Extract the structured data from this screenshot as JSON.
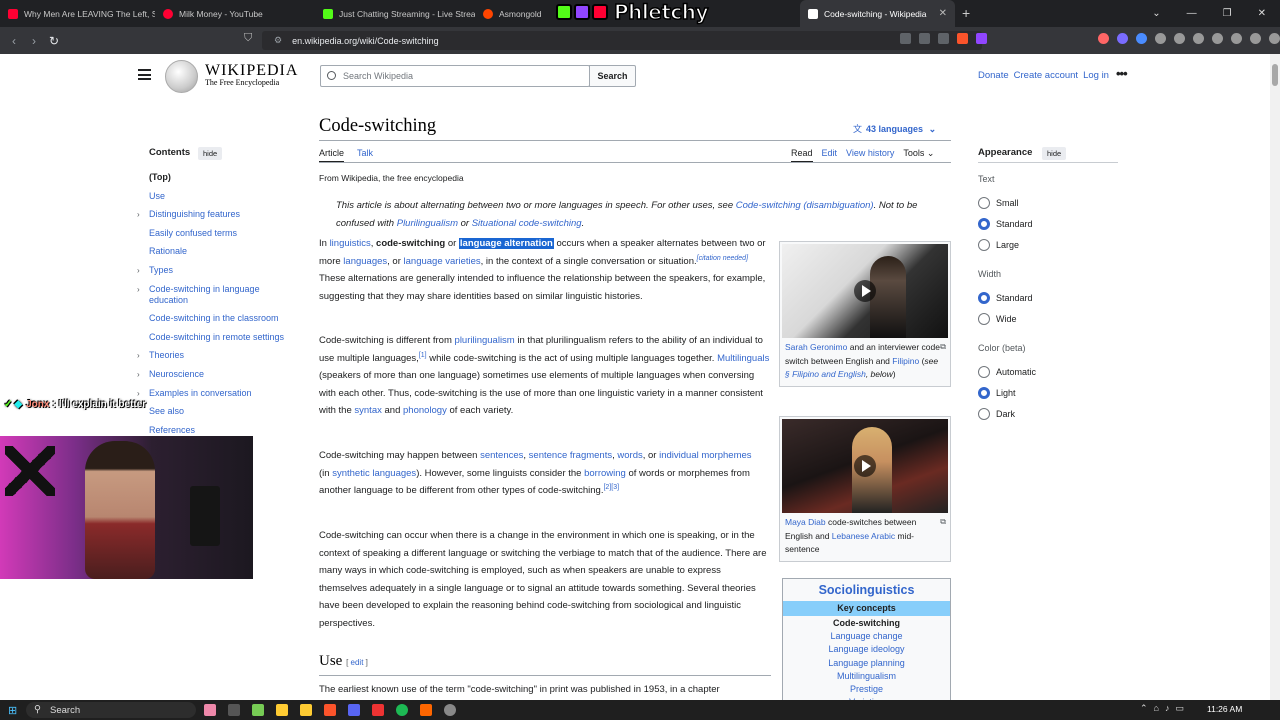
{
  "browser": {
    "tabs": [
      {
        "title": "Why Men Are LEAVING The Left, So",
        "color": "#ff0033"
      },
      {
        "title": "Milk Money - YouTube",
        "color": "#ff0033"
      },
      {
        "title": "Just Chatting Streaming - Live Strea",
        "color": "#53fc18"
      },
      {
        "title": "Asmongold",
        "color": "#ff4500"
      },
      {
        "title": "Code-switching - Wikipedia",
        "color": "#ffffff"
      }
    ],
    "overlay_text": "Phletchy",
    "url": "en.wikipedia.org/wiki/Code-switching"
  },
  "wiki": {
    "wordmark": "Wikipedia",
    "tagline": "The Free Encyclopedia",
    "search_placeholder": "Search Wikipedia",
    "search_button": "Search",
    "top_links": [
      "Donate",
      "Create account",
      "Log in"
    ],
    "toc_title": "Contents",
    "hide_label": "hide",
    "toc": [
      {
        "label": "(Top)",
        "expandable": false
      },
      {
        "label": "Use",
        "expandable": false
      },
      {
        "label": "Distinguishing features",
        "expandable": true
      },
      {
        "label": "Easily confused terms",
        "expandable": false
      },
      {
        "label": "Rationale",
        "expandable": false
      },
      {
        "label": "Types",
        "expandable": true
      },
      {
        "label": "Code-switching in language education",
        "expandable": true
      },
      {
        "label": "Code-switching in the classroom",
        "expandable": false
      },
      {
        "label": "Code-switching in remote settings",
        "expandable": false
      },
      {
        "label": "Theories",
        "expandable": true
      },
      {
        "label": "Neuroscience",
        "expandable": true
      },
      {
        "label": "Examples in conversation",
        "expandable": true
      },
      {
        "label": "See also",
        "expandable": false
      },
      {
        "label": "References",
        "expandable": false
      }
    ],
    "title": "Code-switching",
    "languages": "43 languages",
    "tabs_left": [
      "Article",
      "Talk"
    ],
    "tabs_right": [
      "Read",
      "Edit",
      "View history",
      "Tools"
    ],
    "from": "From Wikipedia, the free encyclopedia",
    "hatnote": {
      "t1": "This article is about alternating between two or more languages in speech. For other uses, see ",
      "l1": "Code-switching (disambiguation)",
      "t2": ". Not to be confused with ",
      "l2": "Plurilingualism",
      "t3": " or ",
      "l3": "Situational code-switching",
      "t4": "."
    },
    "p1": {
      "a": "In ",
      "l1": "linguistics",
      "b": ", ",
      "bold1": "code-switching",
      "c": " or ",
      "highlight": "language alternation",
      "d": " occurs when a speaker alternates between two or more ",
      "l2": "languages",
      "e": ", or ",
      "l3": "language varieties",
      "f": ", in the context of a single conversation or situation.",
      "cite": "[citation needed]",
      "g": " These alternations are generally intended to influence the relationship between the speakers, for example, suggesting that they may share identities based on similar linguistic histories."
    },
    "p2": {
      "a": "Code-switching is different from ",
      "l1": "plurilingualism",
      "b": " in that plurilingualism refers to the ability of an individual to use multiple languages,",
      "s1": "[1]",
      "c": " while code-switching is the act of using multiple languages together. ",
      "l2": "Multilinguals",
      "d": " (speakers of more than one language) sometimes use elements of multiple languages when conversing with each other. Thus, code-switching is the use of more than one linguistic variety in a manner consistent with the ",
      "l3": "syntax",
      "e": " and ",
      "l4": "phonology",
      "f": " of each variety."
    },
    "p3": {
      "a": "Code-switching may happen between ",
      "l1": "sentences",
      "b": ", ",
      "l2": "sentence fragments",
      "c": ", ",
      "l3": "words",
      "d": ", or ",
      "l4": "individual morphemes",
      "e": " (in ",
      "l5": "synthetic languages",
      "f": "). However, some linguists consider the ",
      "l6": "borrowing",
      "g": " of words or morphemes from another language to be different from other types of code-switching.",
      "s1": "[2][3]"
    },
    "p4": "Code-switching can occur when there is a change in the environment in which one is speaking, or in the context of speaking a different language or switching the verbiage to match that of the audience. There are many ways in which code-switching is employed, such as when speakers are unable to express themselves adequately in a single language or to signal an attitude towards something. Several theories have been developed to explain the reasoning behind code-switching from sociological and linguistic perspectives.",
    "use_heading": "Use",
    "edit_link": "edit",
    "use_p": "The earliest known use of the term \"code-switching\" in print was published in 1953, in a chapter",
    "fig1": {
      "l1": "Sarah Geronimo",
      "a": " and an interviewer code-switch between English and ",
      "l2": "Filipino",
      "b": " (",
      "i1": "see ",
      "l3": "§ Filipino and English",
      "i2": ", below",
      "c": ")"
    },
    "fig2": {
      "l1": "Maya Diab",
      "a": " code-switches between English and ",
      "l2": "Lebanese Arabic",
      "b": " mid-sentence"
    },
    "socio": {
      "title": "Sociolinguistics",
      "key": "Key concepts",
      "items": [
        "Code-switching",
        "Language change",
        "Language ideology",
        "Language planning",
        "Multilingualism",
        "Prestige",
        "Variation"
      ]
    },
    "appearance": {
      "title": "Appearance",
      "text_label": "Text",
      "text_options": [
        "Small",
        "Standard",
        "Large"
      ],
      "text_selected": "Standard",
      "width_label": "Width",
      "width_options": [
        "Standard",
        "Wide"
      ],
      "width_selected": "Standard",
      "color_label": "Color (beta)",
      "color_options": [
        "Automatic",
        "Light",
        "Dark"
      ],
      "color_selected": "Light"
    }
  },
  "stream": {
    "chat_user": "Jonx",
    "chat_sep": ":",
    "chat_msg": "I'll explain it better"
  },
  "taskbar": {
    "search": "Search",
    "time": "11:26 AM"
  }
}
